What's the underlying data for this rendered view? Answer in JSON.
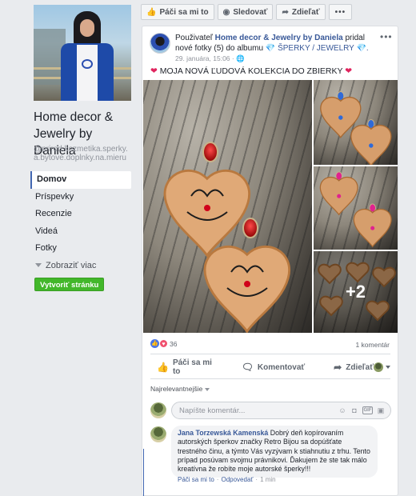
{
  "page": {
    "name": "Home decor & Jewelry by Daniela",
    "handle": "@prirod.kozmetika.sperky.a.bytove.doplnky.na.mieru"
  },
  "nav": {
    "items": [
      {
        "label": "Domov"
      },
      {
        "label": "Príspevky"
      },
      {
        "label": "Recenzie"
      },
      {
        "label": "Videá"
      },
      {
        "label": "Fotky"
      }
    ],
    "more_label": "Zobraziť viac",
    "create_label": "Vytvoriť stránku"
  },
  "topbar": {
    "like_label": "Páči sa mi to",
    "follow_label": "Sledovať",
    "share_label": "Zdieľať",
    "more_label": "•••"
  },
  "post": {
    "user_label": "Použivateľ",
    "page_name": "Home decor & Jewelry by Daniela",
    "added_text": "pridal nové fotky (5) do albumu",
    "album_name": "💎 ŠPERKY / JEWELRY 💎.",
    "time": "29. januára, 15:06 · 🌐",
    "text": "MOJA NOVÁ ĽUDOVÁ KOLEKCIA DO ZBIERKY",
    "more_photos": "+2",
    "reaction_count": "36",
    "comment_count": "1 komentár"
  },
  "actions": {
    "like": "Páči sa mi to",
    "comment": "Komentovať",
    "share": "Zdieľať"
  },
  "comments": {
    "sort_label": "Najrelevantnejšie",
    "input_placeholder": "Napíšte komentár...",
    "items": [
      {
        "author": "Jana Torzewská Kamenská",
        "text": "Dobrý deň kopírovaním autorských šperkov značky Retro Bijou sa dopúšťate trestného činu, a týmto Vás vyzývam k stiahnutiu z trhu. Tento prípad posúvam svojmu právnikovi. Ďakujem že ste tak málo kreatívna že robíte moje autorské šperky!!!",
        "like_label": "Páči sa mi to",
        "reply_label": "Odpovedať",
        "time": "1 min"
      }
    ]
  },
  "colors": {
    "brand_blue": "#4267b2",
    "link_blue": "#385898",
    "green_button": "#42b72a",
    "heart_red": "#e0245e"
  },
  "icons": [
    "thumbs-up-icon",
    "rss-icon",
    "share-arrow-icon",
    "globe-icon",
    "comment-icon",
    "emoji-icon",
    "camera-icon",
    "gif-icon",
    "sticker-icon"
  ]
}
